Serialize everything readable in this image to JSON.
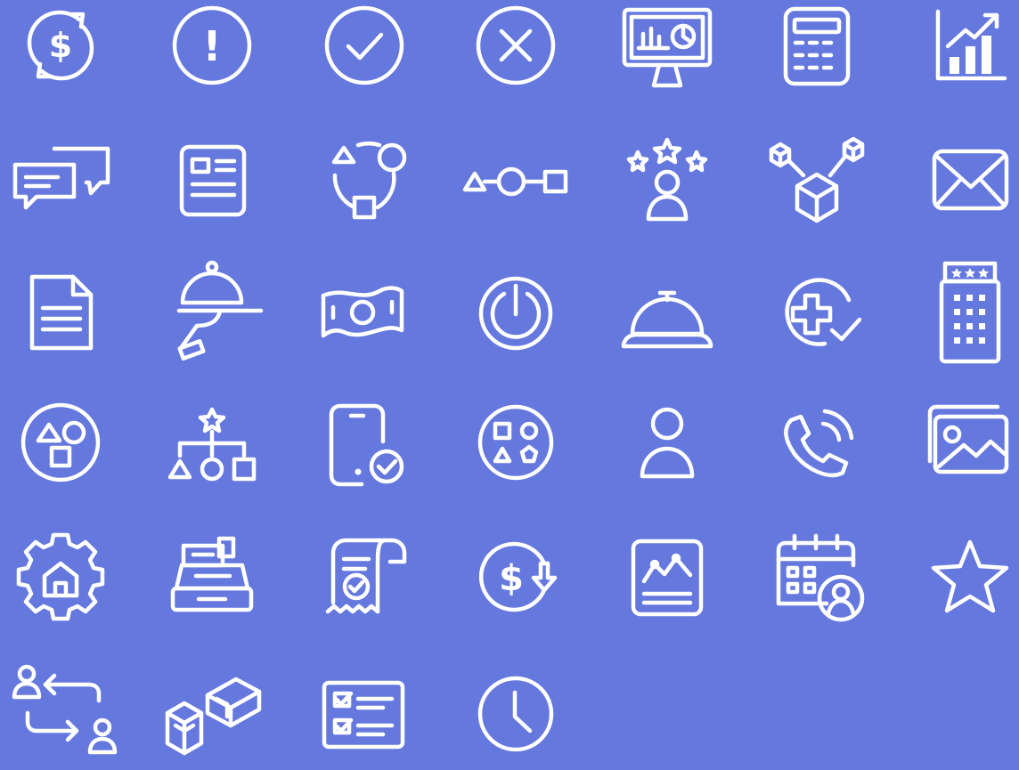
{
  "canvas": {
    "background": "#6578de",
    "icon_color": "#ffffff"
  },
  "icons": [
    {
      "name": "dollar-cycle-icon",
      "glyph": "$"
    },
    {
      "name": "exclamation-circle-icon",
      "glyph": "!"
    },
    {
      "name": "check-circle-icon"
    },
    {
      "name": "x-circle-icon"
    },
    {
      "name": "monitor-analytics-icon"
    },
    {
      "name": "calculator-icon"
    },
    {
      "name": "growth-chart-icon"
    },
    {
      "name": "chat-bubbles-icon"
    },
    {
      "name": "newspaper-icon"
    },
    {
      "name": "shapes-cycle-icon"
    },
    {
      "name": "shapes-flow-icon"
    },
    {
      "name": "user-rating-stars-icon"
    },
    {
      "name": "cube-network-icon"
    },
    {
      "name": "envelope-icon"
    },
    {
      "name": "document-icon"
    },
    {
      "name": "serving-cloche-hand-icon"
    },
    {
      "name": "banknote-icon"
    },
    {
      "name": "power-icon"
    },
    {
      "name": "service-bell-icon"
    },
    {
      "name": "medical-plus-check-icon"
    },
    {
      "name": "hotel-building-icon"
    },
    {
      "name": "shapes-circle-icon"
    },
    {
      "name": "shapes-hierarchy-icon"
    },
    {
      "name": "mobile-check-icon"
    },
    {
      "name": "shapes-badge-icon"
    },
    {
      "name": "user-icon"
    },
    {
      "name": "phone-call-icon"
    },
    {
      "name": "image-gallery-icon"
    },
    {
      "name": "home-settings-icon"
    },
    {
      "name": "cash-register-icon"
    },
    {
      "name": "receipt-check-icon"
    },
    {
      "name": "dollar-down-icon",
      "glyph": "$"
    },
    {
      "name": "line-chart-report-icon"
    },
    {
      "name": "calendar-user-icon"
    },
    {
      "name": "star-icon"
    },
    {
      "name": "user-swap-icon"
    },
    {
      "name": "blocks-icon"
    },
    {
      "name": "checklist-icon"
    },
    {
      "name": "clock-icon"
    }
  ]
}
